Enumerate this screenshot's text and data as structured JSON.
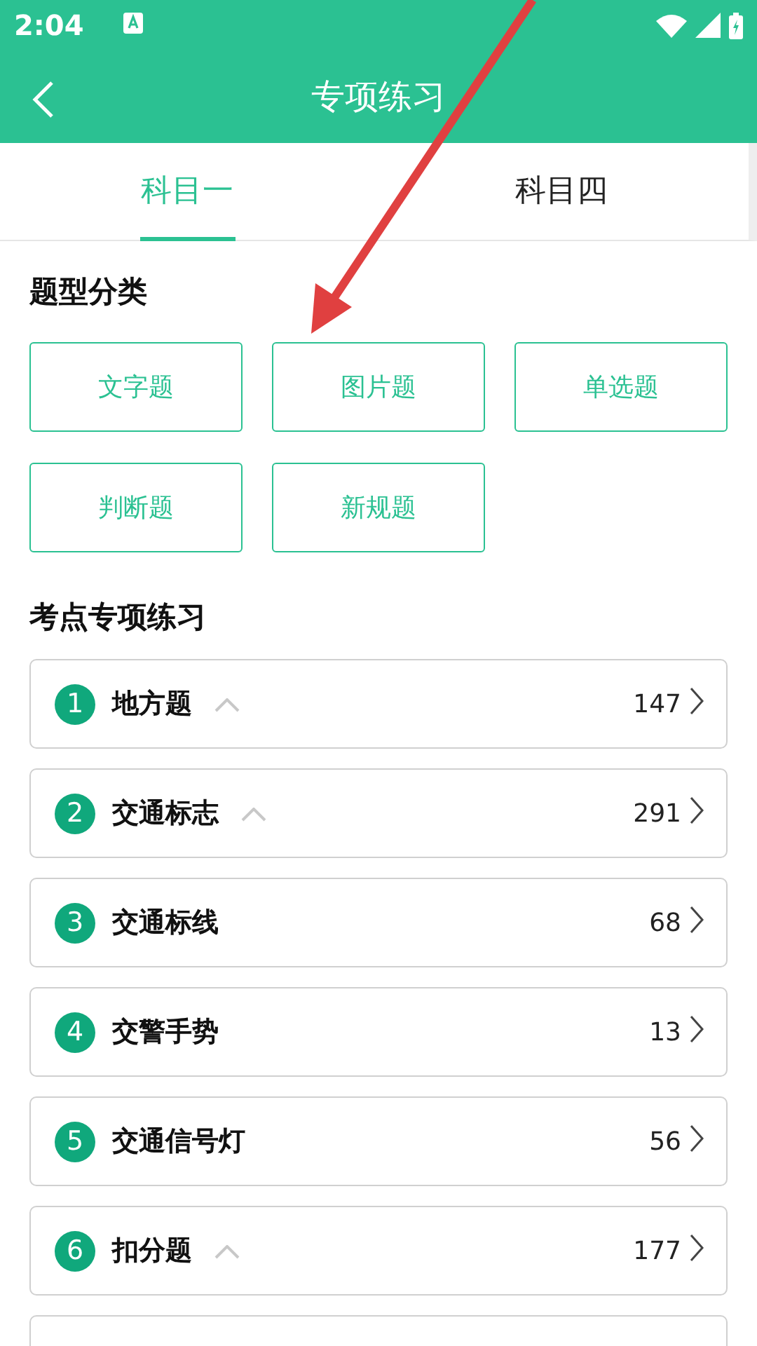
{
  "status_bar": {
    "time": "2:04"
  },
  "header": {
    "title": "专项练习"
  },
  "tabs": [
    {
      "label": "科目一",
      "selected": true
    },
    {
      "label": "科目四",
      "selected": false
    }
  ],
  "question_types": {
    "title": "题型分类",
    "buttons": [
      "文字题",
      "图片题",
      "单选题",
      "判断题",
      "新规题"
    ]
  },
  "practice": {
    "title": "考点专项练习",
    "items": [
      {
        "number": "1",
        "label": "地方题",
        "count": "147",
        "kind": "expandable"
      },
      {
        "number": "2",
        "label": "交通标志",
        "count": "291",
        "kind": "expandable"
      },
      {
        "number": "3",
        "label": "交通标线",
        "count": "68",
        "kind": "plain"
      },
      {
        "number": "4",
        "label": "交警手势",
        "count": "13",
        "kind": "plain"
      },
      {
        "number": "5",
        "label": "交通信号灯",
        "count": "56",
        "kind": "plain"
      },
      {
        "number": "6",
        "label": "扣分题",
        "count": "177",
        "kind": "expandable"
      },
      {
        "kind": "empty"
      }
    ]
  }
}
